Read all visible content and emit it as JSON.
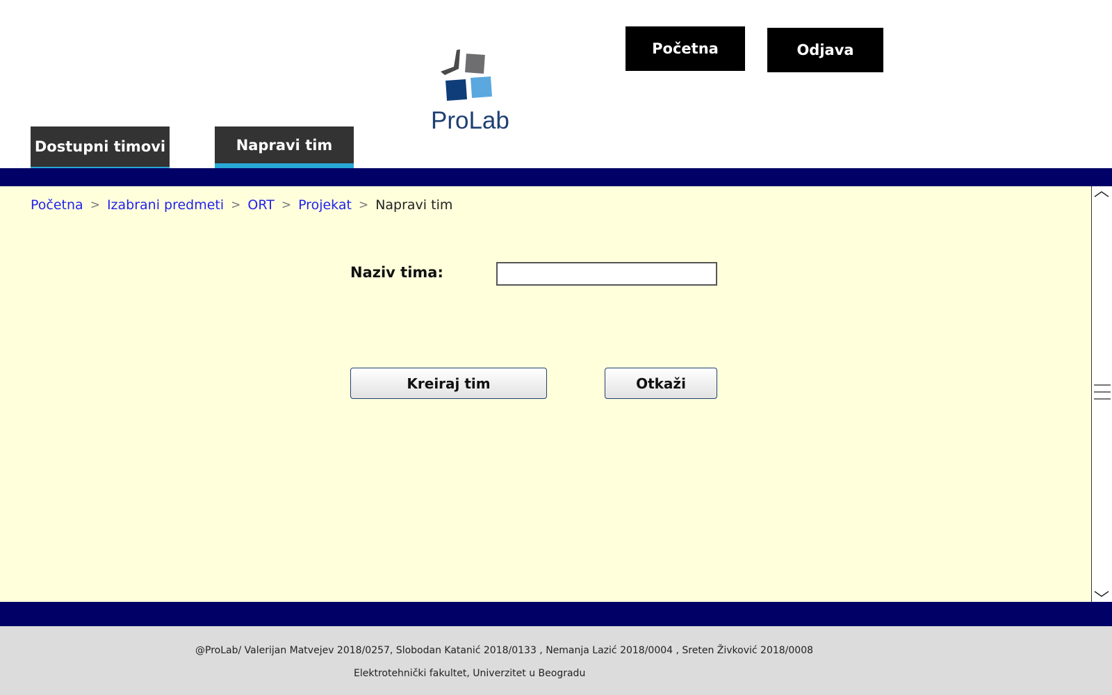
{
  "header": {
    "logo_text": "ProLab",
    "home_button": "Početna",
    "logout_button": "Odjava"
  },
  "tabs": [
    {
      "label": "Dostupni timovi",
      "active": false
    },
    {
      "label": "Napravi tim",
      "active": true
    }
  ],
  "breadcrumb": {
    "items": [
      "Početna",
      "Izabrani predmeti",
      "ORT",
      "Projekat"
    ],
    "separator": ">",
    "current": "Napravi tim"
  },
  "form": {
    "name_label": "Naziv tima:",
    "name_value": "",
    "create_button": "Kreiraj tim",
    "cancel_button": "Otkaži"
  },
  "footer": {
    "line1": "@ProLab/ Valerijan Matvejev 2018/0257, Slobodan Katanić 2018/0133 , Nemanja Lazić 2018/0004 , Sreten Živković 2018/0008",
    "line2": "Elektrotehnički fakultet, Univerzitet u Beogradu"
  },
  "colors": {
    "navy_bar": "#000066",
    "content_bg": "#ffffdc",
    "tab_bg": "#333333",
    "tab_accent": "#29a9d6",
    "link": "#2222ee",
    "footer_bg": "#dcdcdc"
  },
  "icons": {
    "logo": "prolab-logo-icon",
    "scroll_up": "chevron-up-icon",
    "scroll_down": "chevron-down-icon",
    "scroll_grip": "grip-lines-icon"
  }
}
